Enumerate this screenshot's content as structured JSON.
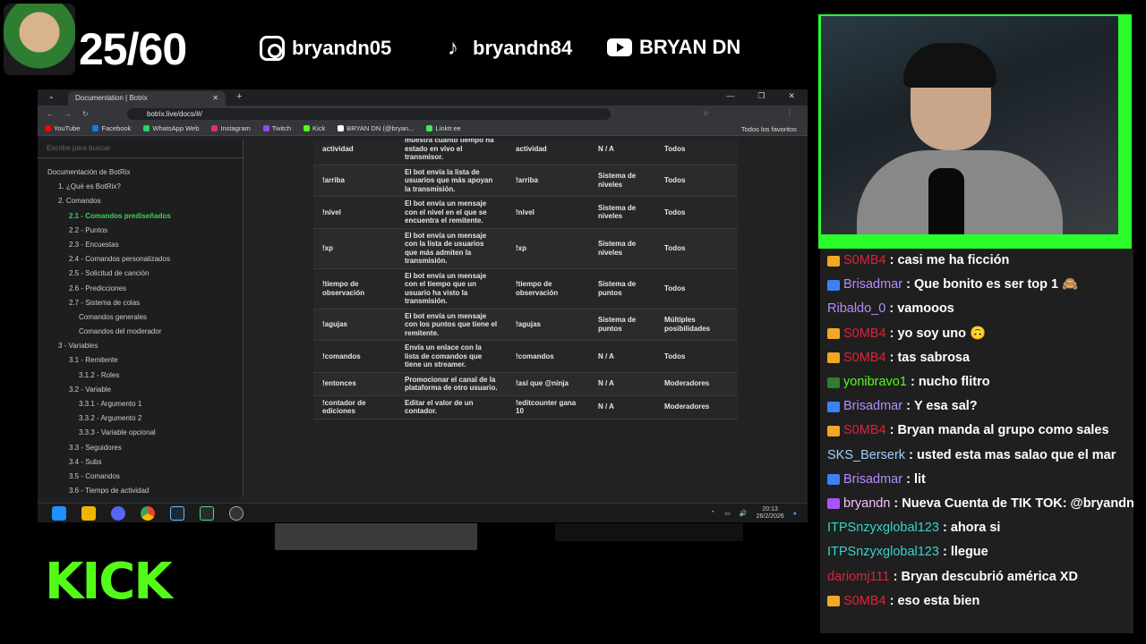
{
  "overlay": {
    "counter": "25/60",
    "instagram": "bryandn05",
    "tiktok": "bryandn84",
    "youtube": "BRYAN DN",
    "kick_logo": "KICK"
  },
  "browser": {
    "tab_title": "Documentation | Botrix",
    "url": "botrix.live/docs/#/",
    "bookmarks": [
      {
        "label": "YouTube",
        "color": "#ff0000"
      },
      {
        "label": "Facebook",
        "color": "#1877f2"
      },
      {
        "label": "WhatsApp Web",
        "color": "#25d366"
      },
      {
        "label": "Instagram",
        "color": "#e1306c"
      },
      {
        "label": "Twitch",
        "color": "#9146ff"
      },
      {
        "label": "Kick",
        "color": "#53fc18"
      },
      {
        "label": "BRYAN DN (@bryan...",
        "color": "#ffffff"
      },
      {
        "label": "Linktr.ee",
        "color": "#43e55e"
      }
    ],
    "favorites_label": "Todos los favoritos"
  },
  "sidebar": {
    "search_placeholder": "Escribe para buscar",
    "items": [
      {
        "label": "Documentación de BotRix",
        "level": 0
      },
      {
        "label": "1. ¿Qué es BotRix?",
        "level": 1
      },
      {
        "label": "2. Comandos",
        "level": 1
      },
      {
        "label": "2.1 - Comandos prediseñados",
        "level": 2,
        "active": true
      },
      {
        "label": "2.2 - Puntos",
        "level": 2
      },
      {
        "label": "2.3 - Encuestas",
        "level": 2
      },
      {
        "label": "2.4 - Comandos personalizados",
        "level": 2
      },
      {
        "label": "2.5 - Solicitud de canción",
        "level": 2
      },
      {
        "label": "2.6 - Predicciones",
        "level": 2
      },
      {
        "label": "2.7 - Sistema de colas",
        "level": 2
      },
      {
        "label": "Comandos generales",
        "level": 3
      },
      {
        "label": "Comandos del moderador",
        "level": 3
      },
      {
        "label": "3 - Variables",
        "level": 1
      },
      {
        "label": "3.1 - Remitente",
        "level": 2
      },
      {
        "label": "3.1.2 - Roles",
        "level": 3
      },
      {
        "label": "3.2 - Variable",
        "level": 2
      },
      {
        "label": "3.3.1 - Argumento 1",
        "level": 3
      },
      {
        "label": "3.3.2 - Argumento 2",
        "level": 3
      },
      {
        "label": "3.3.3 - Variable opcional",
        "level": 3
      },
      {
        "label": "3.3 - Seguidores",
        "level": 2
      },
      {
        "label": "3.4 - Subs",
        "level": 2
      },
      {
        "label": "3.5 - Comandos",
        "level": 2
      },
      {
        "label": "3.6 - Tiempo de actividad",
        "level": 2
      }
    ]
  },
  "table": {
    "rows": [
      [
        "actividad",
        "muestra cuánto tiempo ha estado en vivo el transmisor.",
        "actividad",
        "N / A",
        "Todos"
      ],
      [
        "!arriba",
        "El bot envía la lista de usuarios que más apoyan la transmisión.",
        "!arriba",
        "Sistema de niveles",
        "Todos"
      ],
      [
        "!nivel",
        "El bot envía un mensaje con el nivel en el que se encuentra el remitente.",
        "!nivel",
        "Sistema de niveles",
        "Todos"
      ],
      [
        "!xp",
        "El bot envía un mensaje con la lista de usuarios que más admiten la transmisión.",
        "!xp",
        "Sistema de niveles",
        "Todos"
      ],
      [
        "!tiempo de observación",
        "El bot envía un mensaje con el tiempo que un usuario ha visto la transmisión.",
        "!tiempo de observación",
        "Sistema de puntos",
        "Todos"
      ],
      [
        "!agujas",
        "El bot envía un mensaje con los puntos que tiene el remitente.",
        "!agujas",
        "Sistema de puntos",
        "Múltiples posibilidades"
      ],
      [
        "!comandos",
        "Envía un enlace con la lista de comandos que tiene un streamer.",
        "!comandos",
        "N / A",
        "Todos"
      ],
      [
        "!entonces",
        "Promocionar el canal de la plataforma de otro usuario.",
        "!así que @ninja",
        "N / A",
        "Moderadores"
      ],
      [
        "!contador de ediciones",
        "Editar el valor de un contador.",
        "!editcounter gana 10",
        "N / A",
        "Moderadores"
      ]
    ]
  },
  "taskbar": {
    "time": "20:13",
    "date": "26/2/2026"
  },
  "chat": {
    "messages": [
      {
        "user": "S0MB4",
        "text": "casi me ha ficción",
        "color": "#e0223a",
        "badge": "#f5a623"
      },
      {
        "user": "Brisadmar",
        "text": "Que bonito es ser top 1 🙈",
        "color": "#b58cff",
        "badge": "#3b82f6"
      },
      {
        "user": "Ribaldo_0",
        "text": "vamooos",
        "color": "#b58cff",
        "badge": ""
      },
      {
        "user": "S0MB4",
        "text": "yo soy uno 🙃",
        "color": "#e0223a",
        "badge": "#f5a623"
      },
      {
        "user": "S0MB4",
        "text": "tas sabrosa",
        "color": "#e0223a",
        "badge": "#f5a623"
      },
      {
        "user": "yonibravo1",
        "text": "nucho flitro",
        "color": "#53fc18",
        "badge": "#2e7d32"
      },
      {
        "user": "Brisadmar",
        "text": "Y esa sal?",
        "color": "#b58cff",
        "badge": "#3b82f6"
      },
      {
        "user": "S0MB4",
        "text": "Bryan manda al grupo como sales",
        "color": "#e0223a",
        "badge": "#f5a623"
      },
      {
        "user": "SKS_Berserk",
        "text": "usted esta mas salao que el mar",
        "color": "#9ecfff",
        "badge": ""
      },
      {
        "user": "Brisadmar",
        "text": "lit",
        "color": "#b58cff",
        "badge": "#3b82f6"
      },
      {
        "user": "bryandn",
        "text": "Nueva Cuenta de TIK TOK: @bryandn",
        "color": "#f6c1ff",
        "badge": "#a855f7"
      },
      {
        "user": "ITPSnzyxglobal123",
        "text": "ahora si",
        "color": "#37d3c8",
        "badge": ""
      },
      {
        "user": "ITPSnzyxglobal123",
        "text": "llegue",
        "color": "#37d3c8",
        "badge": ""
      },
      {
        "user": "dariomj111",
        "text": "Bryan descubrió américa XD",
        "color": "#e0223a",
        "badge": ""
      },
      {
        "user": "S0MB4",
        "text": "eso esta bien",
        "color": "#e0223a",
        "badge": "#f5a623"
      }
    ]
  }
}
